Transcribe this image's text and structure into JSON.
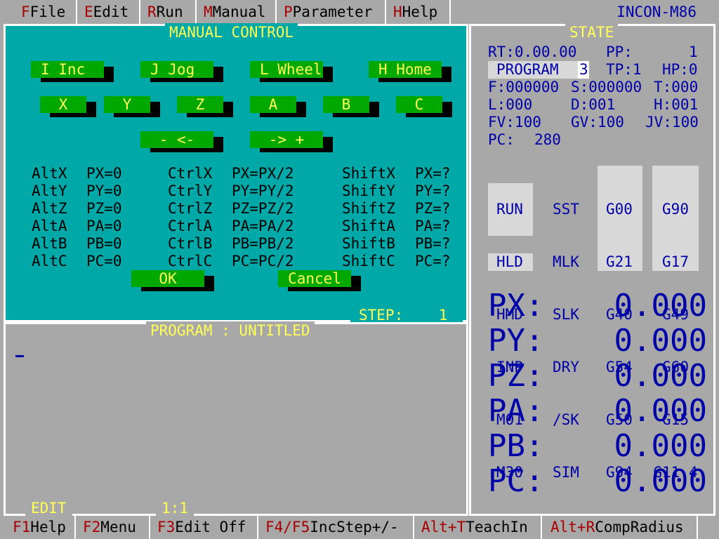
{
  "menubar": {
    "items": [
      {
        "hotkey": "F",
        "label": "File"
      },
      {
        "hotkey": "E",
        "label": "Edit"
      },
      {
        "hotkey": "R",
        "label": "Run"
      },
      {
        "hotkey": "M",
        "label": "Manual"
      },
      {
        "hotkey": "P",
        "label": "Parameter"
      },
      {
        "hotkey": "H",
        "label": "Help"
      }
    ],
    "brand": "INCON-M86"
  },
  "manual": {
    "title": "MANUAL CONTROL",
    "modes": {
      "inc": "I Inc",
      "jog": "J Jog",
      "wheel": "L Wheel",
      "home": "H Home"
    },
    "axes": {
      "x": "X",
      "y": "Y",
      "z": "Z",
      "a": "A",
      "b": "B",
      "c": "C"
    },
    "minus": "- <-",
    "plus": "-> +",
    "shortcuts": {
      "alt_keys": [
        "AltX",
        "AltY",
        "AltZ",
        "AltA",
        "AltB",
        "AltC"
      ],
      "alt_actions": [
        "PX=0",
        "PY=0",
        "PZ=0",
        "PA=0",
        "PB=0",
        "PC=0"
      ],
      "ctrl_keys": [
        "CtrlX",
        "CtrlY",
        "CtrlZ",
        "CtrlA",
        "CtrlB",
        "CtrlC"
      ],
      "ctrl_actions": [
        "PX=PX/2",
        "PY=PY/2",
        "PZ=PZ/2",
        "PA=PA/2",
        "PB=PB/2",
        "PC=PC/2"
      ],
      "shift_keys": [
        "ShiftX",
        "ShiftY",
        "ShiftZ",
        "ShiftA",
        "ShiftB",
        "ShiftC"
      ],
      "shift_actions": [
        "PX=?",
        "PY=?",
        "PZ=?",
        "PA=?",
        "PB=?",
        "PC=?"
      ]
    },
    "ok": "OK",
    "cancel": "Cancel",
    "step_label": "STEP:",
    "step_value": "1"
  },
  "program": {
    "title": "PROGRAM : UNTITLED",
    "mode": "EDIT",
    "position": "1:1"
  },
  "state": {
    "title": "STATE",
    "rt": "RT:0.00.00",
    "pp_label": "PP:",
    "pp_value": "1",
    "program_label": "PROGRAM",
    "program_value": "3",
    "tp": "TP:1",
    "hp": "HP:0",
    "f": "F:000000",
    "s": "S:000000",
    "t": "T:000",
    "l": "L:000",
    "d": "D:001",
    "h": "H:001",
    "fv": "FV:100",
    "gv": "GV:100",
    "jv": "JV:100",
    "pc_label": "PC:",
    "pc_value": "280",
    "status_col1": [
      "RUN",
      "HLD",
      "HMD",
      "INP",
      "M01",
      "M30"
    ],
    "status_col2": [
      "SST",
      "MLK",
      "SLK",
      "DRY",
      "/SK",
      "SIM"
    ],
    "gcode_col1": [
      "G00",
      "G21",
      "G40",
      "G54",
      "G50",
      "G94"
    ],
    "gcode_col2": [
      "G90",
      "G17",
      "G49",
      "G60",
      "G15",
      "G11.4"
    ],
    "positions": [
      {
        "label": "PX:",
        "value": "0.000"
      },
      {
        "label": "PY:",
        "value": "0.000"
      },
      {
        "label": "PZ:",
        "value": "0.000"
      },
      {
        "label": "PA:",
        "value": "0.000"
      },
      {
        "label": "PB:",
        "value": "0.000"
      },
      {
        "label": "PC:",
        "value": "0.000"
      }
    ]
  },
  "fkeys": [
    {
      "hotkey": "F1",
      "label": "Help"
    },
    {
      "hotkey": "F2",
      "label": "Menu"
    },
    {
      "hotkey": "F3",
      "label": "Edit Off"
    },
    {
      "hotkey": "F4/F5",
      "label": "IncStep+/-"
    },
    {
      "hotkey": "Alt+T",
      "label": "TeachIn"
    },
    {
      "hotkey": "Alt+R",
      "label": "CompRadius"
    }
  ]
}
